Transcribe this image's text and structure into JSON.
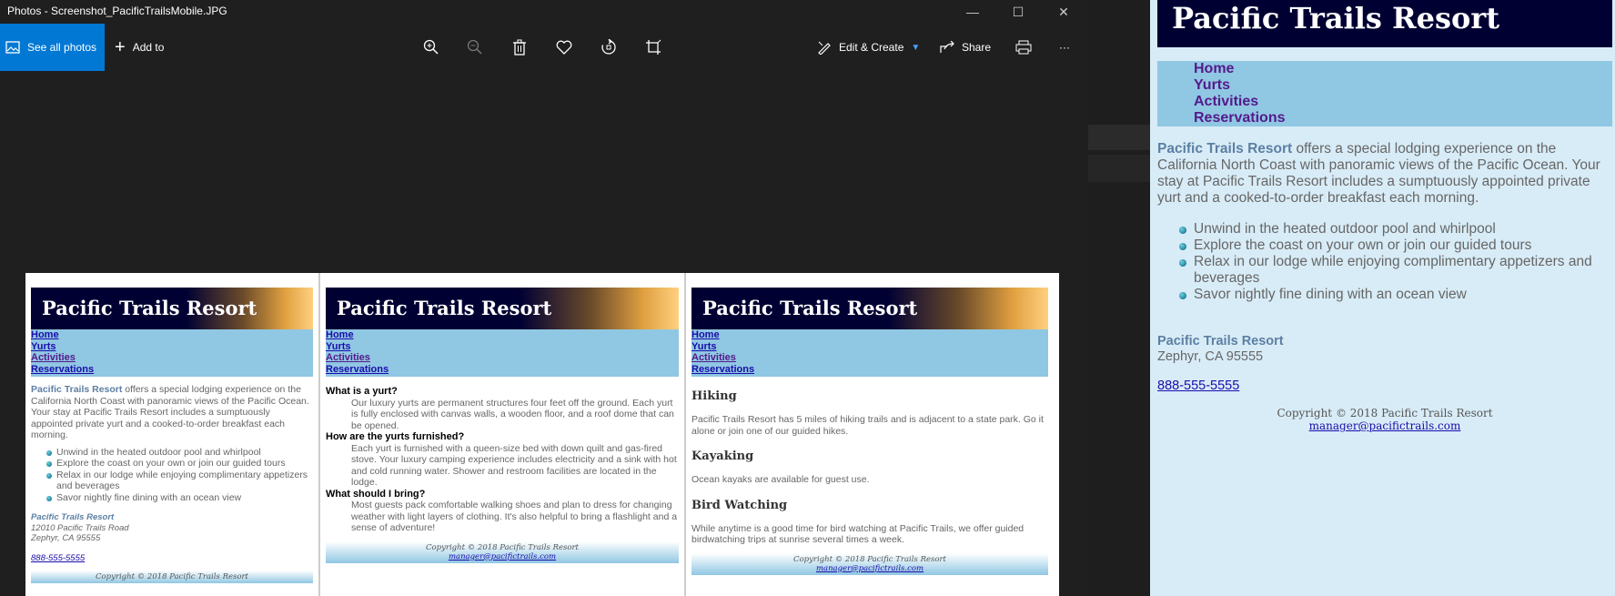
{
  "window": {
    "title": "Photos - Screenshot_PacificTrailsMobile.JPG",
    "minimize": "—",
    "maximize": "☐",
    "close": "✕"
  },
  "toolbar": {
    "see_all": "See all photos",
    "add_to": "Add to",
    "edit_create": "Edit & Create",
    "share": "Share",
    "more": "···"
  },
  "site": {
    "brand": "Pacific Trails Resort",
    "nav": [
      "Home",
      "Yurts",
      "Activities",
      "Reservations"
    ],
    "intro_lead": "Pacific Trails Resort",
    "intro_rest": " offers a special lodging experience on the California North Coast with panoramic views of the Pacific Ocean. Your stay at Pacific Trails Resort includes a sumptuously appointed private yurt and a cooked-to-order breakfast each morning.",
    "features": [
      "Unwind in the heated outdoor pool and whirlpool",
      "Explore the coast on your own or join our guided tours",
      "Relax in our lodge while enjoying complimentary appetizers and beverages",
      "Savor nightly fine dining with an ocean view"
    ],
    "address_name": "Pacific Trails Resort",
    "address_street": "12010 Pacific Trails Road",
    "address_city": "Zephyr, CA 95555",
    "phone": "888-555-5555",
    "copyright": "Copyright © 2018 Pacific Trails Resort",
    "email": "manager@pacifictrails.com"
  },
  "yurts": [
    {
      "q": "What is a yurt?",
      "a": "Our luxury yurts are permanent structures four feet off the ground. Each yurt is fully enclosed with canvas walls, a wooden floor, and a roof dome that can be opened."
    },
    {
      "q": "How are the yurts furnished?",
      "a": "Each yurt is furnished with a queen-size bed with down quilt and gas-fired stove. Your luxury camping experience includes electricity and a sink with hot and cold running water. Shower and restroom facilities are located in the lodge."
    },
    {
      "q": "What should I bring?",
      "a": "Most guests pack comfortable walking shoes and plan to dress for changing weather with light layers of clothing. It's also helpful to bring a flashlight and a sense of adventure!"
    }
  ],
  "activities": [
    {
      "h": "Hiking",
      "p": "Pacific Trails Resort has 5 miles of hiking trails and is adjacent to a state park. Go it alone or join one of our guided hikes."
    },
    {
      "h": "Kayaking",
      "p": "Ocean kayaks are available for guest use."
    },
    {
      "h": "Bird Watching",
      "p": "While anytime is a good time for bird watching at Pacific Trails, we offer guided birdwatching trips at sunrise several times a week."
    }
  ]
}
